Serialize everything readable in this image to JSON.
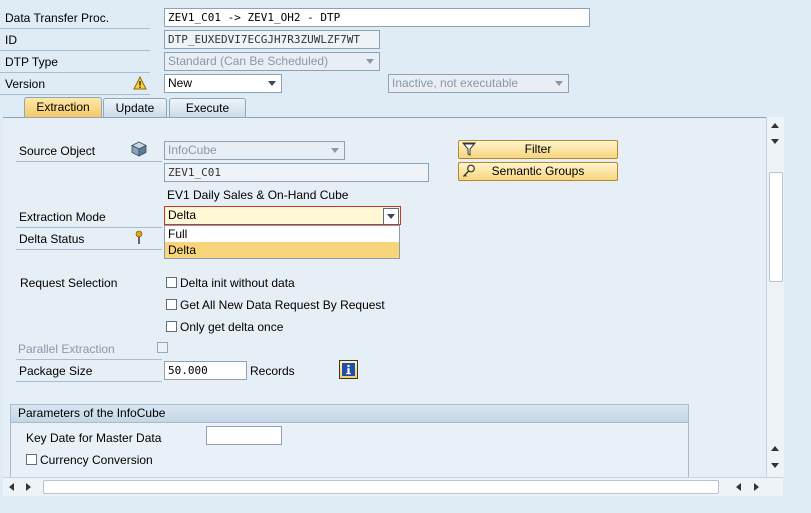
{
  "header": {
    "dtp_label": "Data Transfer Proc.",
    "dtp_value": "ZEV1_C01 -> ZEV1_OH2 - DTP",
    "id_label": "ID",
    "id_value": "DTP_EUXEDVI7ECGJH7R3ZUWLZF7WT",
    "type_label": "DTP Type",
    "type_value": "Standard (Can Be Scheduled)",
    "version_label": "Version",
    "version_value": "New",
    "status_value": "Inactive, not executable"
  },
  "tabs": [
    {
      "label": "Extraction"
    },
    {
      "label": "Update"
    },
    {
      "label": "Execute"
    }
  ],
  "extraction": {
    "source_object_label": "Source Object",
    "source_type": "InfoCube",
    "source_name": "ZEV1_C01",
    "source_desc": "EV1 Daily Sales & On-Hand Cube",
    "filter_button": "Filter",
    "semantic_groups_button": "Semantic Groups",
    "extraction_mode_label": "Extraction Mode",
    "extraction_mode_value": "Delta",
    "extraction_mode_options": [
      "Full",
      "Delta"
    ],
    "delta_status_label": "Delta Status",
    "request_selection_label": "Request Selection",
    "opt_delta_init": "Delta init without data",
    "opt_get_all": "Get All New Data Request By Request",
    "opt_only_delta_once": "Only get delta once",
    "parallel_extraction_label": "Parallel Extraction",
    "package_size_label": "Package Size",
    "package_size_value": "50.000",
    "records_label": "Records"
  },
  "infocube_params": {
    "title": "Parameters of the InfoCube",
    "key_date_label": "Key Date for Master Data",
    "key_date_value": "",
    "currency_conversion_label": "Currency Conversion"
  },
  "icons": {
    "warning": "warning-triangle-icon",
    "cube": "infocube-icon",
    "filter": "filter-icon",
    "semantic": "semantic-groups-icon",
    "info": "info-icon",
    "delta_status": "status-light-icon"
  }
}
